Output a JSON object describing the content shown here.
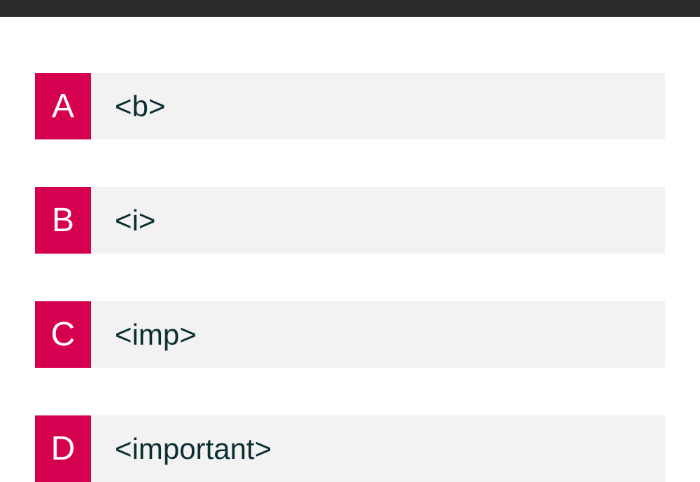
{
  "options": [
    {
      "letter": "A",
      "text": "<b>"
    },
    {
      "letter": "B",
      "text": "<i>"
    },
    {
      "letter": "C",
      "text": "<imp>"
    },
    {
      "letter": "D",
      "text": "<important>"
    }
  ],
  "colors": {
    "accent": "#d60050",
    "option_bg": "#f2f2f2",
    "text_dark": "#0b2e33",
    "topbar": "#2b2b2b"
  }
}
